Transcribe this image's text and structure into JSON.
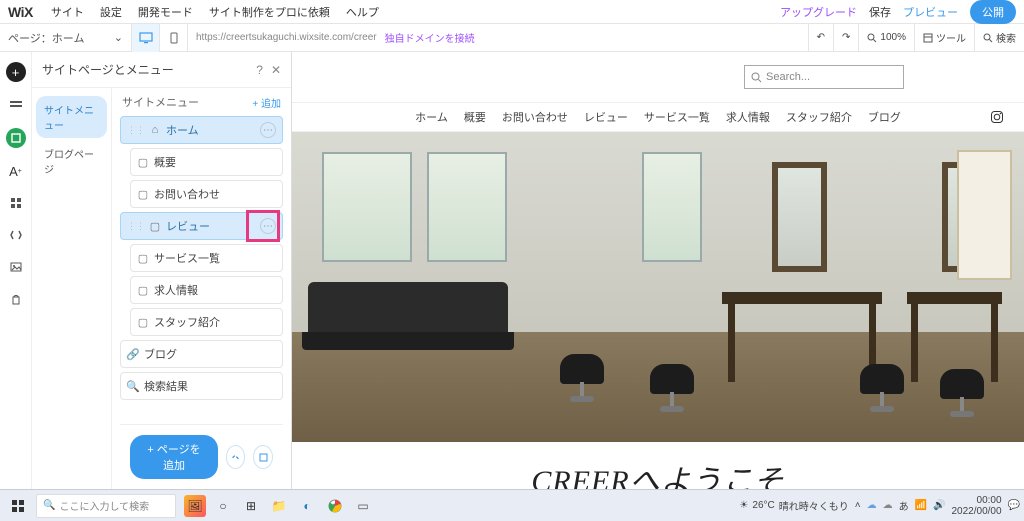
{
  "top_menu": {
    "logo": "WiX",
    "items": [
      "サイト",
      "設定",
      "開発モード",
      "サイト制作をプロに依頼",
      "ヘルプ"
    ],
    "upgrade": "アップグレード",
    "save": "保存",
    "preview": "プレビュー",
    "publish": "公開"
  },
  "second_bar": {
    "page_label": "ページ：ホーム",
    "url": "https://creertsukaguchi.wixsite.com/creer",
    "connect_domain": "独自ドメインを接続",
    "zoom": "100%",
    "tools": "ツール",
    "search": "検索"
  },
  "pages_panel": {
    "title": "サイトページとメニュー",
    "nav": {
      "site_menu": "サイトメニュー",
      "blog_pages": "ブログページ"
    },
    "list_header": "サイトメニュー",
    "add": "+ 追加",
    "items": [
      {
        "label": "ホーム",
        "icon": "home",
        "selected": true,
        "sub": false
      },
      {
        "label": "概要",
        "icon": "page",
        "selected": false,
        "sub": true
      },
      {
        "label": "お問い合わせ",
        "icon": "page",
        "selected": false,
        "sub": true
      },
      {
        "label": "レビュー",
        "icon": "page",
        "selected": true,
        "sub": false,
        "highlighted": true
      },
      {
        "label": "サービス一覧",
        "icon": "page",
        "selected": false,
        "sub": true
      },
      {
        "label": "求人情報",
        "icon": "page",
        "selected": false,
        "sub": true
      },
      {
        "label": "スタッフ紹介",
        "icon": "page",
        "selected": false,
        "sub": true
      },
      {
        "label": "ブログ",
        "icon": "link",
        "selected": false,
        "sub": false
      },
      {
        "label": "検索結果",
        "icon": "search",
        "selected": false,
        "sub": false
      }
    ],
    "add_page_btn": "+ ページを追加"
  },
  "site": {
    "search_placeholder": "Search...",
    "nav": [
      "ホーム",
      "概要",
      "お問い合わせ",
      "レビュー",
      "サービス一覧",
      "求人情報",
      "スタッフ紹介",
      "ブログ"
    ],
    "welcome": "CREERへようこそ"
  },
  "taskbar": {
    "search_placeholder": "ここに入力して検索",
    "weather_temp": "26°C",
    "weather_text": "晴れ時々くもり",
    "time": "00:00",
    "date": "2022/00/00"
  }
}
